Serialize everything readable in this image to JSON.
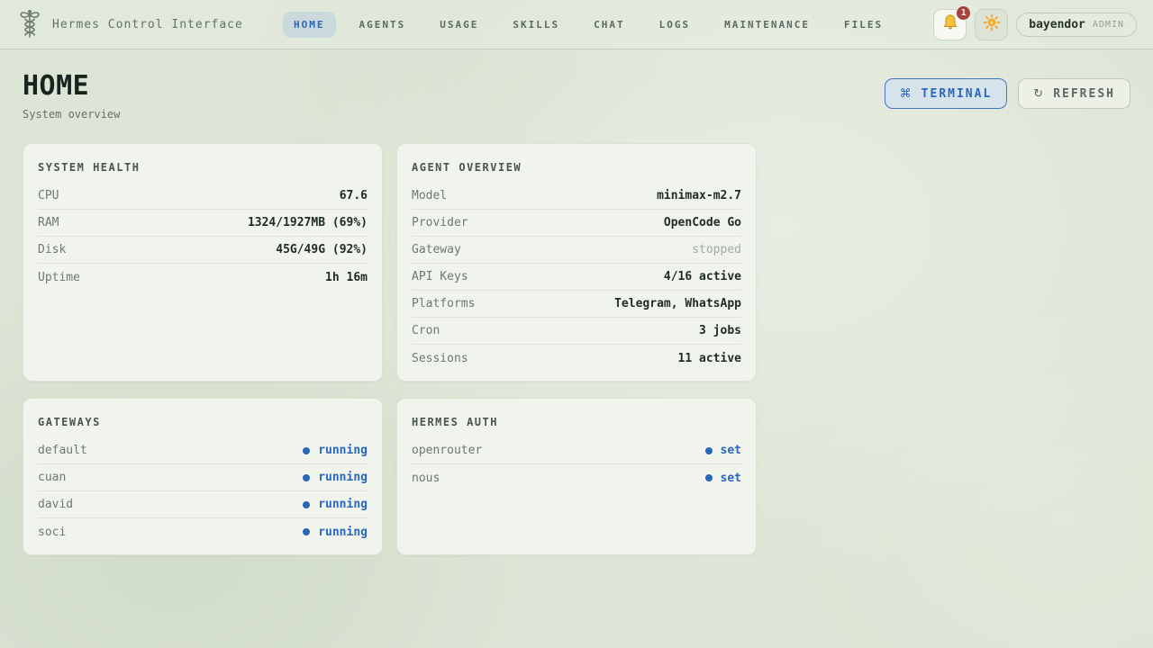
{
  "app": {
    "title": "Hermes Control Interface"
  },
  "nav": {
    "items": [
      {
        "label": "HOME",
        "active": true
      },
      {
        "label": "AGENTS"
      },
      {
        "label": "USAGE"
      },
      {
        "label": "SKILLS"
      },
      {
        "label": "CHAT"
      },
      {
        "label": "LOGS"
      },
      {
        "label": "MAINTENANCE"
      },
      {
        "label": "FILES"
      }
    ]
  },
  "header_actions": {
    "notifications_count": "1",
    "bell_icon": "bell-icon",
    "theme_icon": "sun-icon",
    "user_name": "bayendor",
    "user_role": "ADMIN"
  },
  "page": {
    "title": "HOME",
    "subtitle": "System overview",
    "terminal_icon": "⌘",
    "terminal_label": "TERMINAL",
    "refresh_icon": "↻",
    "refresh_label": "REFRESH"
  },
  "cards": {
    "system_health": {
      "title": "SYSTEM HEALTH",
      "rows": [
        {
          "label": "CPU",
          "value": "67.6"
        },
        {
          "label": "RAM",
          "value": "1324/1927MB (69%)"
        },
        {
          "label": "Disk",
          "value": "45G/49G (92%)"
        },
        {
          "label": "Uptime",
          "value": "1h 16m"
        }
      ]
    },
    "agent_overview": {
      "title": "AGENT OVERVIEW",
      "rows": [
        {
          "label": "Model",
          "value": "minimax-m2.7"
        },
        {
          "label": "Provider",
          "value": "OpenCode Go"
        },
        {
          "label": "Gateway",
          "value": "stopped",
          "muted": true
        },
        {
          "label": "API Keys",
          "value": "4/16 active"
        },
        {
          "label": "Platforms",
          "value": "Telegram, WhatsApp"
        },
        {
          "label": "Cron",
          "value": "3 jobs"
        },
        {
          "label": "Sessions",
          "value": "11 active"
        }
      ]
    },
    "gateways": {
      "title": "GATEWAYS",
      "rows": [
        {
          "label": "default",
          "status": "running"
        },
        {
          "label": "cuan",
          "status": "running"
        },
        {
          "label": "david",
          "status": "running"
        },
        {
          "label": "soci",
          "status": "running"
        }
      ]
    },
    "hermes_auth": {
      "title": "HERMES AUTH",
      "rows": [
        {
          "label": "openrouter",
          "status": "set"
        },
        {
          "label": "nous",
          "status": "set"
        }
      ]
    }
  },
  "colors": {
    "accent_blue": "#2a67ba",
    "badge_red": "#a84040",
    "background_sage": "#dde5d6",
    "card_bg": "#f1f4ec"
  }
}
